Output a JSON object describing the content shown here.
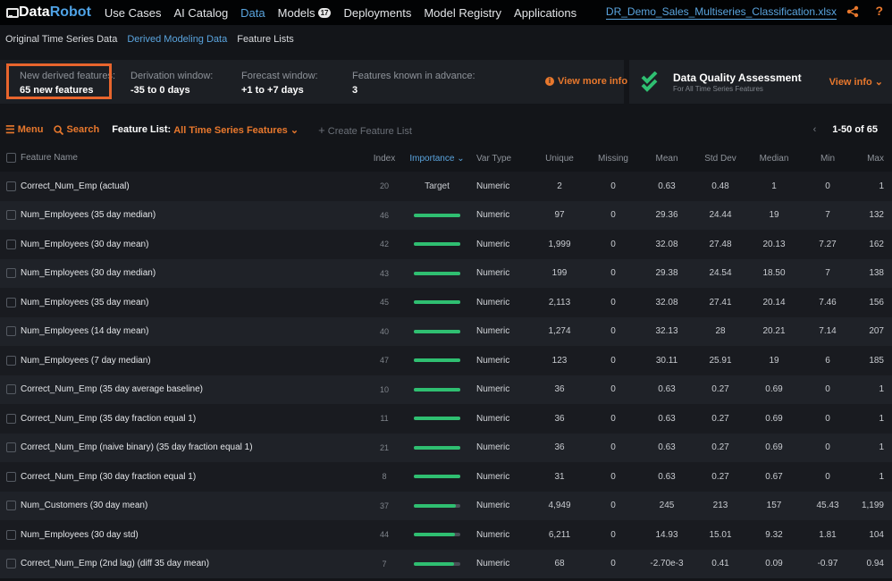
{
  "topnav": {
    "logo_part1": "Data",
    "logo_part2": "Robot",
    "items": [
      {
        "label": "Use Cases"
      },
      {
        "label": "AI Catalog"
      },
      {
        "label": "Data",
        "active": true
      },
      {
        "label": "Models",
        "badge": "17"
      },
      {
        "label": "Deployments"
      },
      {
        "label": "Model Registry"
      },
      {
        "label": "Applications"
      }
    ],
    "filename": "DR_Demo_Sales_Multiseries_Classification.xlsx",
    "help": "?"
  },
  "subnav": {
    "items": [
      {
        "label": "Original Time Series Data"
      },
      {
        "label": "Derived Modeling Data",
        "active": true
      },
      {
        "label": "Feature Lists"
      }
    ]
  },
  "info": {
    "cells": [
      {
        "label": "New derived features:",
        "value": "65 new features"
      },
      {
        "label": "Derivation window:",
        "value": "-35 to 0 days"
      },
      {
        "label": "Forecast window:",
        "value": "+1 to +7 days"
      },
      {
        "label": "Features known in advance:",
        "value": "3"
      }
    ],
    "view_more": "View more info"
  },
  "dqa": {
    "title": "Data Quality Assessment",
    "subtitle": "For All Time Series Features",
    "view_info": "View info"
  },
  "toolbar": {
    "menu": "Menu",
    "search": "Search",
    "feature_list_label": "Feature List:",
    "feature_list_value": "All Time Series Features",
    "create": "Create Feature List",
    "pager_range": "1-50 of 65"
  },
  "colors": {
    "accent_orange": "#e8782d",
    "link_blue": "#5aa4de",
    "importance_green": "#2fbf71"
  },
  "table": {
    "headers": {
      "name": "Feature Name",
      "index": "Index",
      "importance": "Importance",
      "vtype": "Var Type",
      "unique": "Unique",
      "missing": "Missing",
      "mean": "Mean",
      "std": "Std Dev",
      "median": "Median",
      "min": "Min",
      "max": "Max"
    },
    "rows": [
      {
        "name": "Correct_Num_Emp (actual)",
        "index": "20",
        "importance": "Target",
        "imp_fraction": null,
        "vtype": "Numeric",
        "unique": "2",
        "missing": "0",
        "mean": "0.63",
        "std": "0.48",
        "median": "1",
        "min": "0",
        "max": "1"
      },
      {
        "name": "Num_Employees (35 day median)",
        "index": "46",
        "importance": "",
        "imp_fraction": 1.0,
        "vtype": "Numeric",
        "unique": "97",
        "missing": "0",
        "mean": "29.36",
        "std": "24.44",
        "median": "19",
        "min": "7",
        "max": "132"
      },
      {
        "name": "Num_Employees (30 day mean)",
        "index": "42",
        "importance": "",
        "imp_fraction": 1.0,
        "vtype": "Numeric",
        "unique": "1,999",
        "missing": "0",
        "mean": "32.08",
        "std": "27.48",
        "median": "20.13",
        "min": "7.27",
        "max": "162"
      },
      {
        "name": "Num_Employees (30 day median)",
        "index": "43",
        "importance": "",
        "imp_fraction": 1.0,
        "vtype": "Numeric",
        "unique": "199",
        "missing": "0",
        "mean": "29.38",
        "std": "24.54",
        "median": "18.50",
        "min": "7",
        "max": "138"
      },
      {
        "name": "Num_Employees (35 day mean)",
        "index": "45",
        "importance": "",
        "imp_fraction": 1.0,
        "vtype": "Numeric",
        "unique": "2,113",
        "missing": "0",
        "mean": "32.08",
        "std": "27.41",
        "median": "20.14",
        "min": "7.46",
        "max": "156"
      },
      {
        "name": "Num_Employees (14 day mean)",
        "index": "40",
        "importance": "",
        "imp_fraction": 1.0,
        "vtype": "Numeric",
        "unique": "1,274",
        "missing": "0",
        "mean": "32.13",
        "std": "28",
        "median": "20.21",
        "min": "7.14",
        "max": "207"
      },
      {
        "name": "Num_Employees (7 day median)",
        "index": "47",
        "importance": "",
        "imp_fraction": 1.0,
        "vtype": "Numeric",
        "unique": "123",
        "missing": "0",
        "mean": "30.11",
        "std": "25.91",
        "median": "19",
        "min": "6",
        "max": "185"
      },
      {
        "name": "Correct_Num_Emp (35 day average baseline)",
        "index": "10",
        "importance": "",
        "imp_fraction": 1.0,
        "vtype": "Numeric",
        "unique": "36",
        "missing": "0",
        "mean": "0.63",
        "std": "0.27",
        "median": "0.69",
        "min": "0",
        "max": "1"
      },
      {
        "name": "Correct_Num_Emp (35 day fraction equal 1)",
        "index": "11",
        "importance": "",
        "imp_fraction": 1.0,
        "vtype": "Numeric",
        "unique": "36",
        "missing": "0",
        "mean": "0.63",
        "std": "0.27",
        "median": "0.69",
        "min": "0",
        "max": "1"
      },
      {
        "name": "Correct_Num_Emp (naive binary) (35 day fraction equal 1)",
        "index": "21",
        "importance": "",
        "imp_fraction": 1.0,
        "vtype": "Numeric",
        "unique": "36",
        "missing": "0",
        "mean": "0.63",
        "std": "0.27",
        "median": "0.69",
        "min": "0",
        "max": "1"
      },
      {
        "name": "Correct_Num_Emp (30 day fraction equal 1)",
        "index": "8",
        "importance": "",
        "imp_fraction": 1.0,
        "vtype": "Numeric",
        "unique": "31",
        "missing": "0",
        "mean": "0.63",
        "std": "0.27",
        "median": "0.67",
        "min": "0",
        "max": "1"
      },
      {
        "name": "Num_Customers (30 day mean)",
        "index": "37",
        "importance": "",
        "imp_fraction": 0.9,
        "vtype": "Numeric",
        "unique": "4,949",
        "missing": "0",
        "mean": "245",
        "std": "213",
        "median": "157",
        "min": "45.43",
        "max": "1,199"
      },
      {
        "name": "Num_Employees (30 day std)",
        "index": "44",
        "importance": "",
        "imp_fraction": 0.89,
        "vtype": "Numeric",
        "unique": "6,211",
        "missing": "0",
        "mean": "14.93",
        "std": "15.01",
        "median": "9.32",
        "min": "1.81",
        "max": "104"
      },
      {
        "name": "Correct_Num_Emp (2nd lag) (diff 35 day mean)",
        "index": "7",
        "importance": "",
        "imp_fraction": 0.87,
        "vtype": "Numeric",
        "unique": "68",
        "missing": "0",
        "mean": "-2.70e-3",
        "std": "0.41",
        "median": "0.09",
        "min": "-0.97",
        "max": "0.94"
      }
    ]
  }
}
